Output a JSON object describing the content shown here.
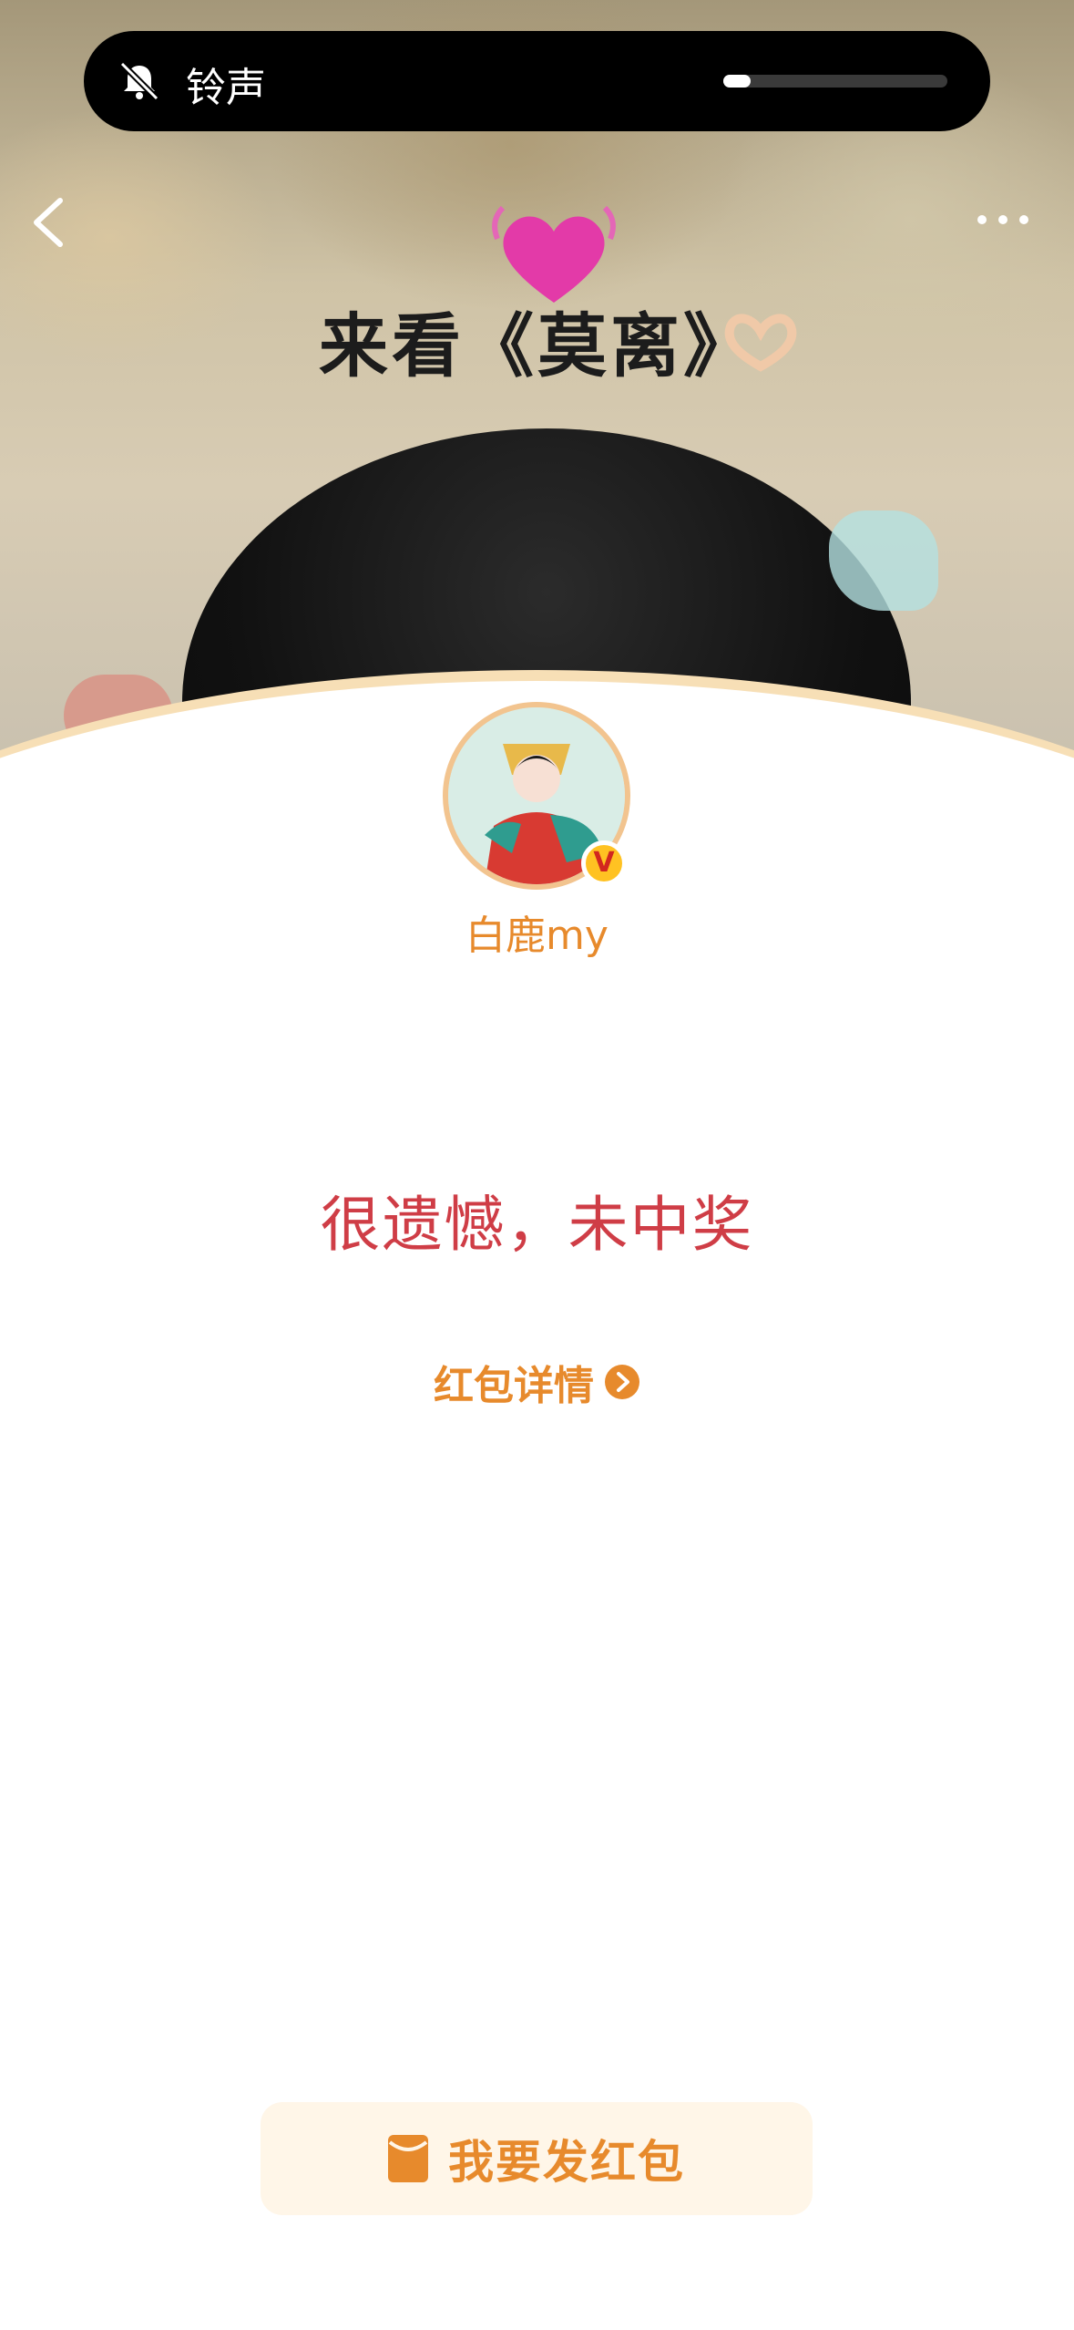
{
  "ringer": {
    "label": "铃声",
    "volume_fraction": 0.12,
    "icon": "bell-muted-icon"
  },
  "nav": {
    "back_icon": "chevron-left-icon",
    "more_icon": "more-dots-icon"
  },
  "hero": {
    "caption": "来看《莫离》",
    "decor_icons": [
      "heart-icon",
      "heart-hands-icon"
    ]
  },
  "sender": {
    "name": "白鹿my",
    "verified_icon": "verified-v-icon"
  },
  "result": {
    "message": "很遗憾，未中奖"
  },
  "detail_link": {
    "label": "红包详情",
    "icon": "chevron-right-circle-icon"
  },
  "send_button": {
    "label": "我要发红包",
    "icon": "red-envelope-icon"
  },
  "colors": {
    "accent_orange": "#e78a2c",
    "result_red": "#cf3d46",
    "button_bg": "#fff6e8"
  }
}
